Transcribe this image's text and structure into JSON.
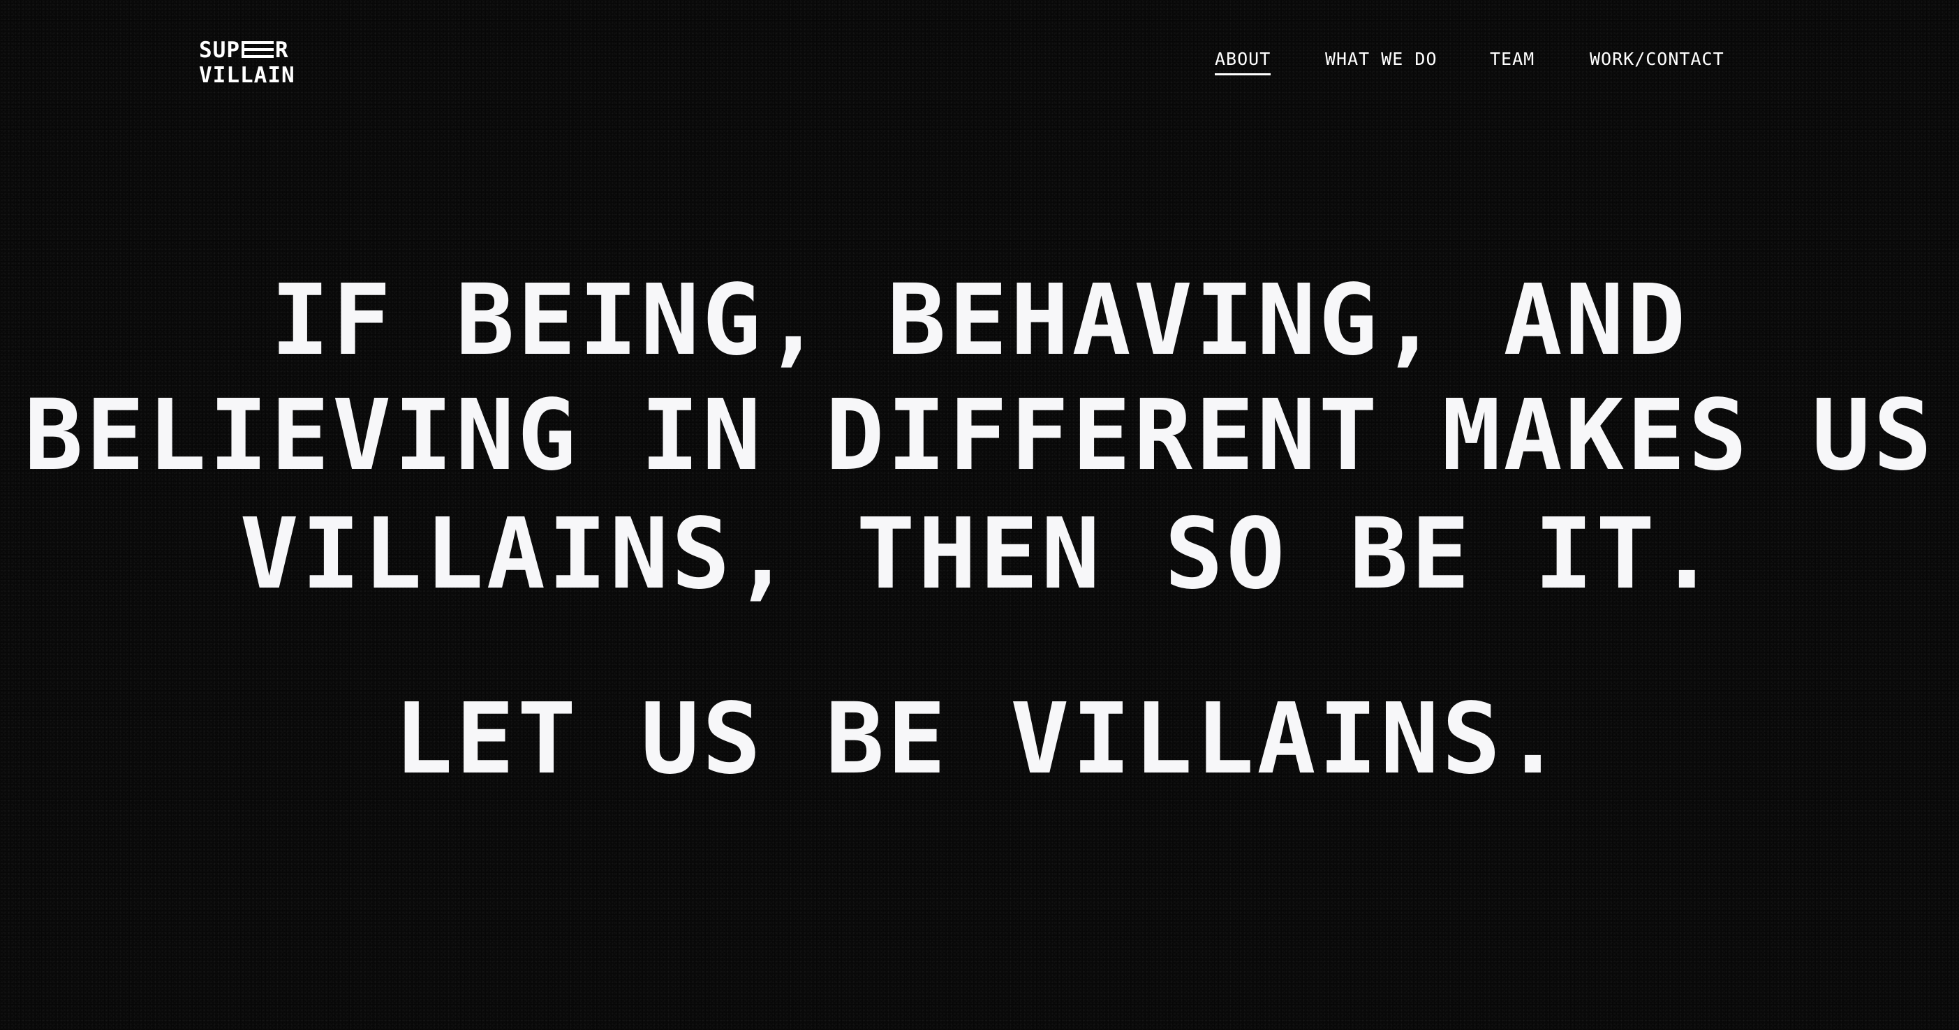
{
  "brand": {
    "line1_prefix": "SUP",
    "line1_suffix": "R",
    "line2": "VILLAIN"
  },
  "nav": {
    "items": [
      {
        "label": "ABOUT",
        "active": true
      },
      {
        "label": "WHAT WE DO",
        "active": false
      },
      {
        "label": "TEAM",
        "active": false
      },
      {
        "label": "WORK/CONTACT",
        "active": false
      }
    ]
  },
  "hero": {
    "line1": "IF BEING, BEHAVING, AND",
    "line2": "BELIEVING IN DIFFERENT MAKES US",
    "line3": "VILLAINS, THEN SO BE IT.",
    "tagline": "LET US BE VILLAINS."
  },
  "colors": {
    "background": "#0b0b0b",
    "text": "#ffffff"
  }
}
